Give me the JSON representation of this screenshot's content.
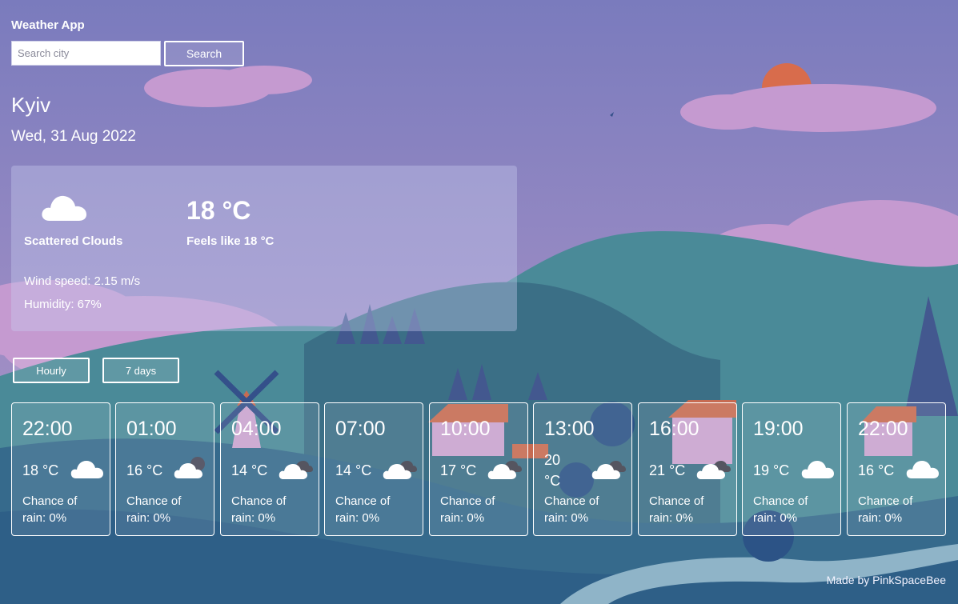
{
  "app": {
    "title": "Weather App"
  },
  "search": {
    "placeholder": "Search city",
    "value": "",
    "button_label": "Search"
  },
  "location": {
    "city": "Kyiv",
    "date": "Wed, 31 Aug 2022"
  },
  "current": {
    "icon": "cloud-icon",
    "description": "Scattered Clouds",
    "temperature": "18 °C",
    "feels_like": "Feels like 18 °C",
    "wind": "Wind speed: 2.15 m/s",
    "humidity": "Humidity: 67%"
  },
  "tabs": [
    {
      "label": "Hourly"
    },
    {
      "label": "7 days"
    }
  ],
  "hourly": [
    {
      "time": "22:00",
      "temp": "18 °C",
      "icon": "cloud-icon",
      "rain": "Chance of rain: 0%"
    },
    {
      "time": "01:00",
      "temp": "16 °C",
      "icon": "cloud-moon-icon",
      "rain": "Chance of rain: 0%"
    },
    {
      "time": "04:00",
      "temp": "14 °C",
      "icon": "broken-clouds-icon",
      "rain": "Chance of rain: 0%"
    },
    {
      "time": "07:00",
      "temp": "14 °C",
      "icon": "broken-clouds-icon",
      "rain": "Chance of rain: 0%"
    },
    {
      "time": "10:00",
      "temp": "17 °C",
      "icon": "broken-clouds-icon",
      "rain": "Chance of rain: 0%"
    },
    {
      "time": "13:00",
      "temp": "20 °C",
      "icon": "broken-clouds-icon",
      "rain": "Chance of rain: 0%"
    },
    {
      "time": "16:00",
      "temp": "21 °C",
      "icon": "broken-clouds-icon",
      "rain": "Chance of rain: 0%"
    },
    {
      "time": "19:00",
      "temp": "19 °C",
      "icon": "cloud-icon",
      "rain": "Chance of rain: 0%"
    },
    {
      "time": "22:00",
      "temp": "16 °C",
      "icon": "cloud-icon",
      "rain": "Chance of rain: 0%"
    }
  ],
  "footer": {
    "credit": "Made by PinkSpaceBee"
  },
  "colors": {
    "sky": "#7f7fb8",
    "sun": "#d86c4c",
    "hills": "#3f7a8c",
    "text": "#ffffff"
  }
}
